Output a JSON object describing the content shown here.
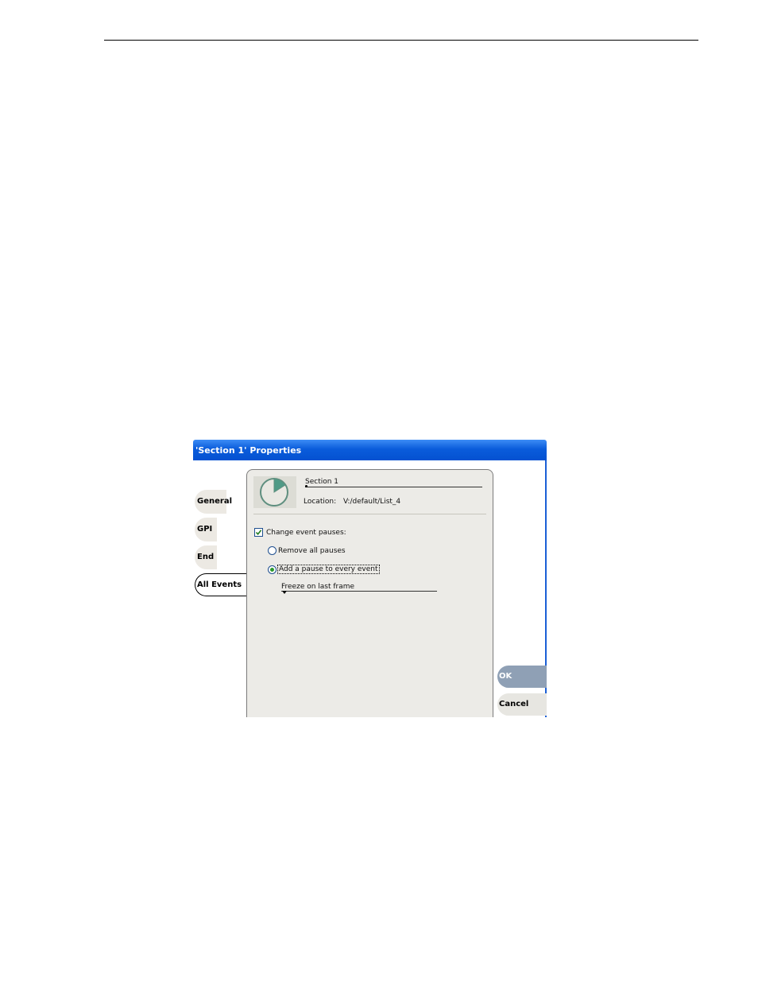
{
  "dialog": {
    "title": "'Section 1' Properties",
    "colors": {
      "titlebar": "#0a5cdb",
      "panel": "#ecebe7",
      "ok_button": "#8fa0b5"
    }
  },
  "tabs": [
    {
      "label": "General"
    },
    {
      "label": "GPI"
    },
    {
      "label": "End"
    },
    {
      "label": "All Events",
      "active": true
    }
  ],
  "header": {
    "icon": "pie-clock-icon",
    "name_value": "Section 1",
    "location_label": "Location:",
    "location_value": "V:/default/List_4"
  },
  "options": {
    "change_pauses_label": "Change event pauses:",
    "change_pauses_checked": true,
    "remove_all_label": "Remove all pauses",
    "add_pause_label": "Add a pause to every event",
    "selected": "add_pause",
    "pause_mode_value": "Freeze on last frame"
  },
  "buttons": {
    "ok": "OK",
    "cancel": "Cancel"
  }
}
